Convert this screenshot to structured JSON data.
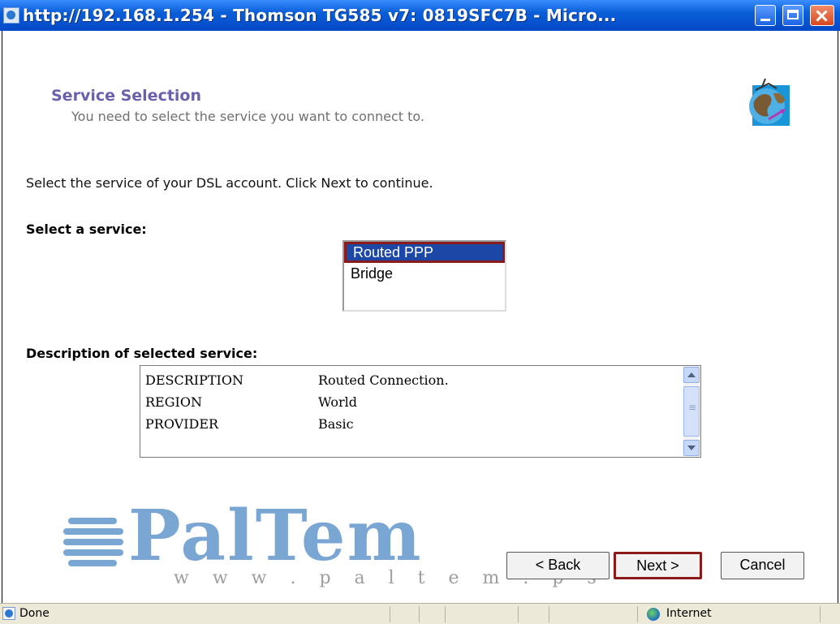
{
  "window": {
    "title": "http://192.168.1.254 - Thomson TG585 v7:  0819SFC7B - Micro..."
  },
  "page": {
    "heading": "Service Selection",
    "subheading": "You need to select the service you want to connect to.",
    "instruction": "Select the service of your DSL account. Click Next to continue.",
    "select_label": "Select a service:",
    "services": [
      {
        "label": "Routed PPP",
        "selected": true
      },
      {
        "label": "Bridge",
        "selected": false
      }
    ],
    "description_label": "Description of selected service:",
    "description": [
      {
        "key": "DESCRIPTION",
        "value": "Routed Connection."
      },
      {
        "key": "REGION",
        "value": "World"
      },
      {
        "key": "PROVIDER",
        "value": "Basic"
      }
    ]
  },
  "watermark": {
    "name": "PalTem",
    "url": "w w w . p a l t e m . p s"
  },
  "buttons": {
    "back": "< Back",
    "next": "Next >",
    "cancel": "Cancel"
  },
  "statusbar": {
    "status": "Done",
    "zone": "Internet"
  },
  "icons": {
    "title": "ie-page-icon",
    "header": "globe-network-icon",
    "status": "ie-page-icon",
    "zone": "internet-globe-icon"
  },
  "colors": {
    "titlebar": "#0a5fd8",
    "heading": "#6b5fae",
    "selection": "#1c47a6",
    "focus_border": "#8b1a1a",
    "watermark": "#7aa6d4"
  }
}
